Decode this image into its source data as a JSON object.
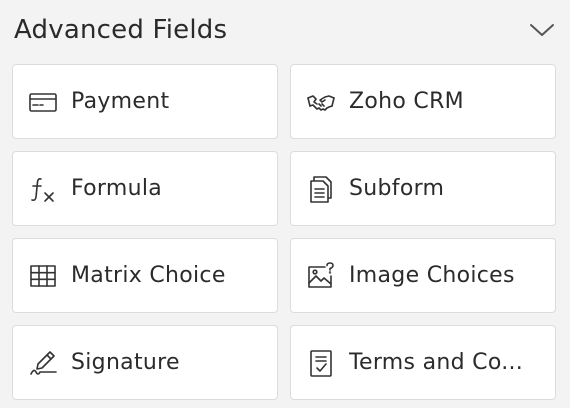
{
  "section": {
    "title": "Advanced Fields",
    "toggle_icon": "chevron-down-icon"
  },
  "fields": [
    {
      "label": "Payment",
      "icon": "credit-card-icon"
    },
    {
      "label": "Zoho CRM",
      "icon": "handshake-icon"
    },
    {
      "label": "Formula",
      "icon": "function-icon"
    },
    {
      "label": "Subform",
      "icon": "document-stack-icon"
    },
    {
      "label": "Matrix Choice",
      "icon": "grid-table-icon"
    },
    {
      "label": "Image Choices",
      "icon": "image-question-icon"
    },
    {
      "label": "Signature",
      "icon": "pen-signature-icon"
    },
    {
      "label": "Terms and Co...",
      "icon": "checklist-document-icon"
    }
  ]
}
